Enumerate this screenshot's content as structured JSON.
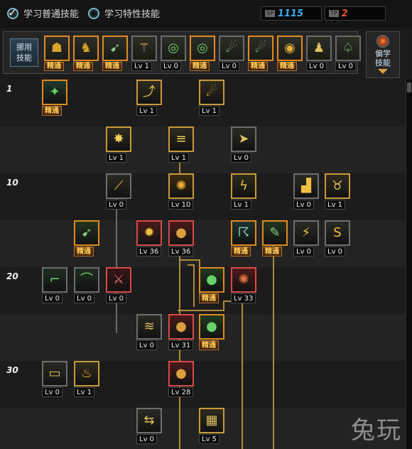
{
  "header": {
    "mode_common": "学习普通技能",
    "mode_special": "学习特性技能",
    "sp_label": "SP",
    "sp_value": "1115",
    "tp_label": "TP",
    "tp_value": "2"
  },
  "quickbar": {
    "label_line1": "挪用",
    "label_line2": "技能",
    "slots": [
      {
        "badge": "精通",
        "master": true,
        "selected": true,
        "glyph": "☗",
        "color": "#d9a42a"
      },
      {
        "badge": "精通",
        "master": true,
        "selected": true,
        "glyph": "♞",
        "color": "#d9a42a"
      },
      {
        "badge": "精通",
        "master": true,
        "selected": true,
        "glyph": "➹",
        "color": "#8bd08a"
      },
      {
        "badge": "Lv 1",
        "master": false,
        "selected": false,
        "glyph": "⚚",
        "color": "#e0c060"
      },
      {
        "badge": "Lv 0",
        "master": false,
        "selected": false,
        "glyph": "◎",
        "color": "#6ad06a"
      },
      {
        "badge": "精通",
        "master": true,
        "selected": true,
        "glyph": "◎",
        "color": "#6ad06a"
      },
      {
        "badge": "Lv 0",
        "master": false,
        "selected": false,
        "glyph": "☄",
        "color": "#9ad09a"
      },
      {
        "badge": "精通",
        "master": true,
        "selected": true,
        "glyph": "☄",
        "color": "#9ad09a"
      },
      {
        "badge": "精通",
        "master": true,
        "selected": true,
        "glyph": "◉",
        "color": "#e0b040"
      },
      {
        "badge": "Lv 0",
        "master": false,
        "selected": false,
        "glyph": "♟",
        "color": "#e0c060"
      },
      {
        "badge": "Lv 0",
        "master": false,
        "selected": false,
        "glyph": "♤",
        "color": "#9ad09a"
      }
    ]
  },
  "skill_book": {
    "line1": "偏学",
    "line2": "技能"
  },
  "levels": [
    {
      "label": "1",
      "band": 0
    },
    {
      "label": "10",
      "band": 2
    },
    {
      "label": "20",
      "band": 4
    },
    {
      "label": "30",
      "band": 6
    }
  ],
  "skills": [
    {
      "id": "s1",
      "badge": "精通",
      "master": true,
      "state": "selected",
      "glyph": "✦",
      "color": "#6ad06a",
      "bg": "#1f3a2a"
    },
    {
      "id": "s2",
      "badge": "Lv 1",
      "master": false,
      "state": "active",
      "glyph": "⤴",
      "color": "#e0c060",
      "bg": "#2e2a1e"
    },
    {
      "id": "s3",
      "badge": "Lv 1",
      "master": false,
      "state": "active",
      "glyph": "☄",
      "color": "#f0c040",
      "bg": "#2e2a1e"
    },
    {
      "id": "s4",
      "badge": "Lv 1",
      "master": false,
      "state": "active",
      "glyph": "✸",
      "color": "#f0d060",
      "bg": "#2e2a1e"
    },
    {
      "id": "s5",
      "badge": "Lv 1",
      "master": false,
      "state": "active",
      "glyph": "≡",
      "color": "#f0d060",
      "bg": "#2e2a1e"
    },
    {
      "id": "s6",
      "badge": "Lv 0",
      "master": false,
      "state": "normal",
      "glyph": "➤",
      "color": "#e0c060",
      "bg": "#2a2a24"
    },
    {
      "id": "s7",
      "badge": "Lv 0",
      "master": false,
      "state": "normal",
      "glyph": "⟋",
      "color": "#f0c040",
      "bg": "#2a2a24"
    },
    {
      "id": "s8",
      "badge": "Lv 10",
      "master": false,
      "state": "active",
      "glyph": "✺",
      "color": "#f0b030",
      "bg": "#3a2a10"
    },
    {
      "id": "s9",
      "badge": "Lv 1",
      "master": false,
      "state": "active",
      "glyph": "ϟ",
      "color": "#f0c040",
      "bg": "#2e2a1e"
    },
    {
      "id": "s10",
      "badge": "Lv 0",
      "master": false,
      "state": "normal",
      "glyph": "▟",
      "color": "#f0c040",
      "bg": "#2a2a24"
    },
    {
      "id": "s11",
      "badge": "Lv 1",
      "master": false,
      "state": "active",
      "glyph": "♉",
      "color": "#e0c060",
      "bg": "#2e2a1e"
    },
    {
      "id": "s12",
      "badge": "精通",
      "master": true,
      "state": "selected",
      "glyph": "➹",
      "color": "#8bd08a",
      "bg": "#24341f"
    },
    {
      "id": "s13",
      "badge": "Lv 36",
      "master": false,
      "state": "enhanced",
      "glyph": "✹",
      "color": "#f0c040",
      "bg": "#4a1a1a"
    },
    {
      "id": "s14",
      "badge": "Lv 36",
      "master": false,
      "state": "enhanced",
      "glyph": "●",
      "color": "#d8a040",
      "bg": "#4a1a1a"
    },
    {
      "id": "s15",
      "badge": "精通",
      "master": true,
      "state": "selected",
      "glyph": "☈",
      "color": "#9ad0c0",
      "bg": "#1f3430"
    },
    {
      "id": "s16",
      "badge": "精通",
      "master": true,
      "state": "selected",
      "glyph": "✎",
      "color": "#8bd08a",
      "bg": "#24341f"
    },
    {
      "id": "s17",
      "badge": "Lv 0",
      "master": false,
      "state": "normal",
      "glyph": "⚡",
      "color": "#f0c040",
      "bg": "#2a2a24"
    },
    {
      "id": "s18",
      "badge": "Lv 0",
      "master": false,
      "state": "normal",
      "glyph": "S",
      "color": "#f0c040",
      "bg": "#2a2a24"
    },
    {
      "id": "s19",
      "badge": "Lv 0",
      "master": false,
      "state": "normal",
      "glyph": "⌐",
      "color": "#7ad07a",
      "bg": "#1f2e22"
    },
    {
      "id": "s20",
      "badge": "Lv 0",
      "master": false,
      "state": "normal",
      "glyph": "⌒",
      "color": "#7ad07a",
      "bg": "#1f2e22"
    },
    {
      "id": "s21",
      "badge": "Lv 0",
      "master": false,
      "state": "enhanced",
      "glyph": "⚔",
      "color": "#e07070",
      "bg": "#3a1414"
    },
    {
      "id": "s22",
      "badge": "精通",
      "master": true,
      "state": "selected",
      "glyph": "●",
      "color": "#6ad06a",
      "bg": "#1f3a1f"
    },
    {
      "id": "s23",
      "badge": "Lv 33",
      "master": false,
      "state": "enhanced",
      "glyph": "✺",
      "color": "#d87040",
      "bg": "#4a1a1a"
    },
    {
      "id": "s24",
      "badge": "Lv 0",
      "master": false,
      "state": "normal",
      "glyph": "≋",
      "color": "#e0c060",
      "bg": "#2a2a24"
    },
    {
      "id": "s25",
      "badge": "Lv 31",
      "master": false,
      "state": "enhanced",
      "glyph": "●",
      "color": "#d8a040",
      "bg": "#4a1a1a"
    },
    {
      "id": "s26",
      "badge": "精通",
      "master": true,
      "state": "selected",
      "glyph": "●",
      "color": "#6ad06a",
      "bg": "#1f3a1f"
    },
    {
      "id": "s27",
      "badge": "Lv 0",
      "master": false,
      "state": "normal",
      "glyph": "▭",
      "color": "#e0c060",
      "bg": "#2a2a24"
    },
    {
      "id": "s28",
      "badge": "Lv 1",
      "master": false,
      "state": "active",
      "glyph": "♨",
      "color": "#f0b030",
      "bg": "#2e2a1e"
    },
    {
      "id": "s29",
      "badge": "Lv 28",
      "master": false,
      "state": "enhanced",
      "glyph": "●",
      "color": "#d8a040",
      "bg": "#4a1a1a"
    },
    {
      "id": "s30",
      "badge": "Lv 0",
      "master": false,
      "state": "normal",
      "glyph": "⇆",
      "color": "#e0c060",
      "bg": "#2a2a24"
    },
    {
      "id": "s31",
      "badge": "Lv 5",
      "master": false,
      "state": "active",
      "glyph": "▦",
      "color": "#e0c060",
      "bg": "#2e2a1e"
    }
  ],
  "watermark": "兔玩"
}
